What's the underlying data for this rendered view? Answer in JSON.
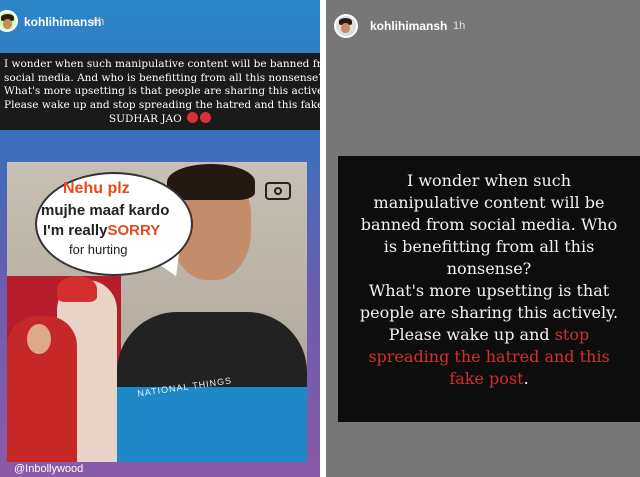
{
  "left_story": {
    "username": "kohlihimansh",
    "timestamp": "4h",
    "caption_lines": [
      "I wonder when such manipulative content will be banned from",
      "social media. And who is benefitting from all this nonsense?",
      "What's more upsetting is that people are sharing this actively.",
      "Please wake up and stop spreading the hatred and this fake post.",
      "SUDHAR JAO"
    ],
    "meme": {
      "line1": "Nehu plz",
      "line2": "mujhe maaf kardo",
      "line3_prefix": "I'm really",
      "line3_highlight": "SORRY",
      "line4": "for hurting",
      "shirt_text": "NATIONAL THINGS"
    },
    "credit": "@Inbollywood"
  },
  "right_story": {
    "username": "kohlihimansh",
    "timestamp": "1h",
    "lines": [
      "I wonder when such",
      "manipulative content will be",
      "banned from social media. Who",
      "is benefitting from all this",
      "nonsense?",
      "What's more upsetting is that",
      "people are sharing this actively."
    ],
    "line8_prefix": "Please wake up and ",
    "line8_red": "stop",
    "line9_red": "spreading the hatred and this",
    "line10_red": "fake post",
    "line10_suffix": "."
  },
  "colors": {
    "highlight_red": "#d32f2f",
    "meme_orange": "#e64a19"
  }
}
